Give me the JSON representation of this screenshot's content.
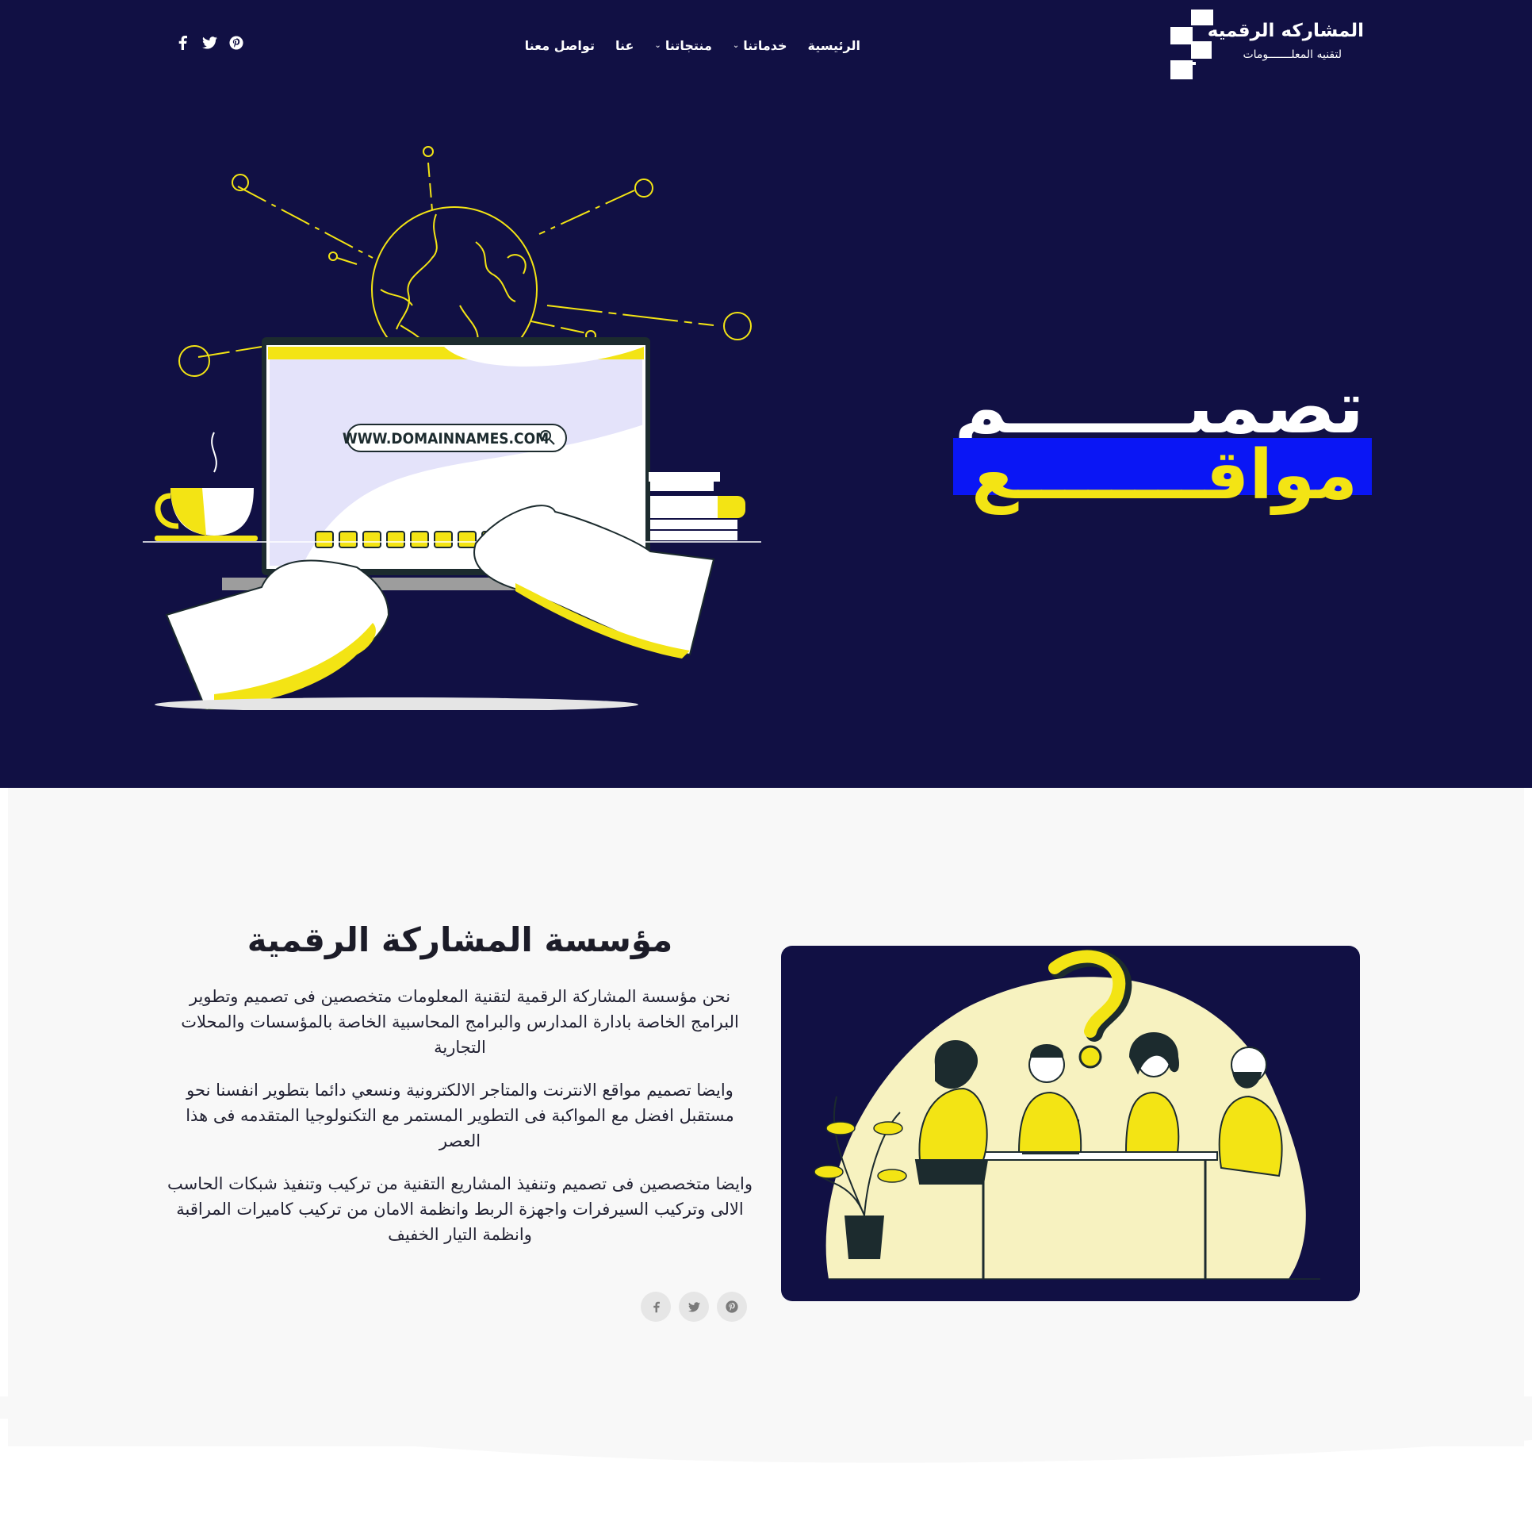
{
  "brand": {
    "name": "المشاركه الرقميه",
    "tagline": "لتقنيه المعلـــــــومات"
  },
  "nav": {
    "items": [
      {
        "label": "الرئيسية",
        "has_dropdown": false
      },
      {
        "label": "خدماتنا",
        "has_dropdown": true
      },
      {
        "label": "منتجاتنا",
        "has_dropdown": true
      },
      {
        "label": "عنا",
        "has_dropdown": false
      },
      {
        "label": "تواصل معنا",
        "has_dropdown": false
      }
    ],
    "social": [
      "facebook-icon",
      "twitter-icon",
      "pinterest-icon"
    ]
  },
  "hero": {
    "title": "تصميـــــــم",
    "subtitle": "مواقــــــــع",
    "search_text": "WWW.DOMAINNAMES.COM"
  },
  "about": {
    "title": "مؤسسة المشاركة الرقمية",
    "paragraphs": [
      "نحن مؤسسة المشاركة الرقمية لتقنية المعلومات متخصصين فى تصميم وتطوير البرامج الخاصة بادارة المدارس والبرامج المحاسبية الخاصة بالمؤسسات والمحلات التجارية",
      "وايضا تصميم مواقع الانترنت والمتاجر الالكترونية ونسعي دائما بتطوير انفسنا نحو مستقبل افضل مع المواكبة فى التطوير المستمر مع التكنولوجيا المتقدمه فى هذا العصر",
      "وايضا متخصصين فى تصميم وتنفيذ المشاريع التقنية من تركيب وتنفيذ شبكات الحاسب الالى وتركيب السيرفرات واجهزة الربط وانظمة الامان من تركيب كاميرات المراقبة وانظمة التيار الخفيف"
    ],
    "social": [
      "facebook-icon",
      "twitter-icon",
      "pinterest-icon"
    ]
  },
  "colors": {
    "navy": "#111044",
    "yellow": "#f3e414",
    "blue": "#0a16f5",
    "light_bg": "#f8f8f8"
  }
}
